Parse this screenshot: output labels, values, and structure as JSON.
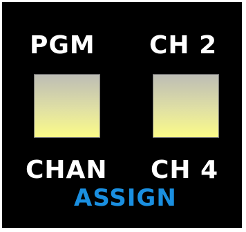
{
  "labels": {
    "top_left": "PGM",
    "top_right": "CH 2",
    "bottom_left": "CHAN",
    "bottom_right": "CH 4",
    "assign": "ASSIGN"
  },
  "colors": {
    "panel_background": "#000000",
    "label_text": "#ffffff",
    "assign_text": "#1a8fe0",
    "button_top": "#bdbdb5",
    "button_bottom": "#fbfb88"
  }
}
